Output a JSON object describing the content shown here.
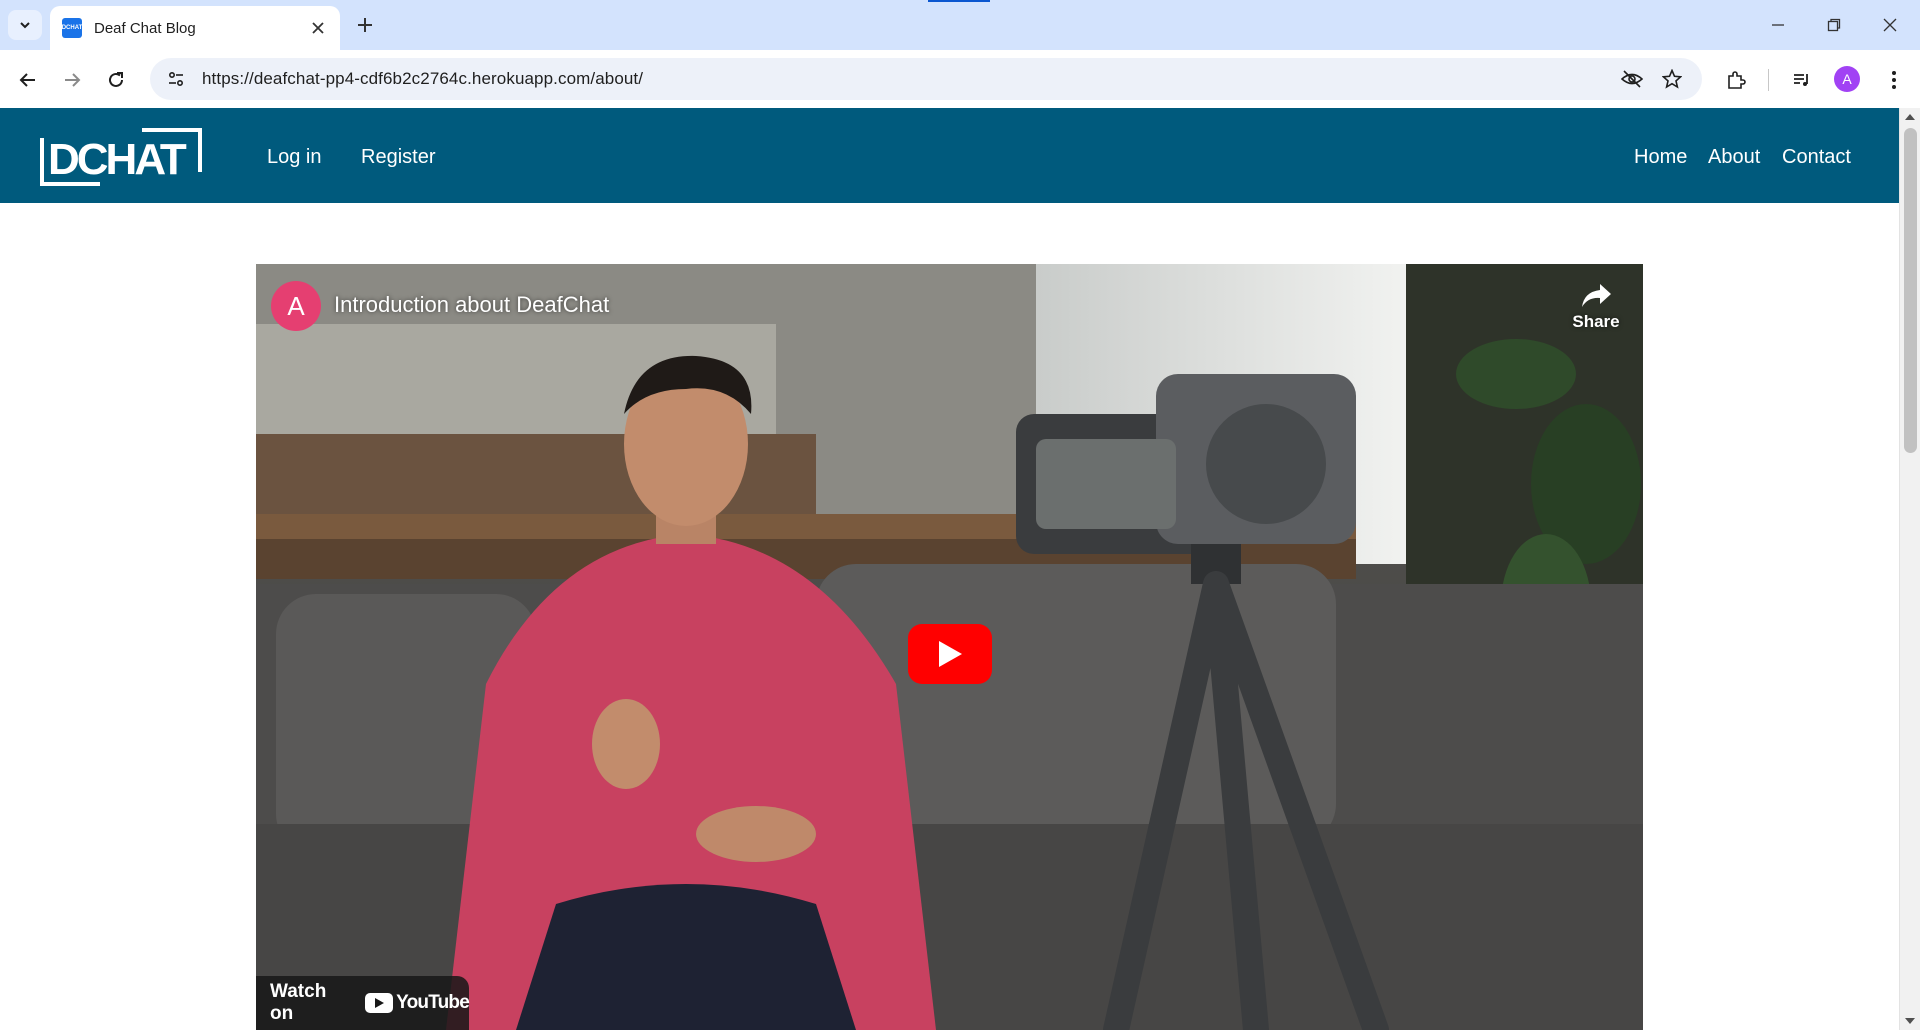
{
  "browser": {
    "tab_title": "Deaf Chat Blog",
    "favicon_text": "DCHAT",
    "url": "https://deafchat-pp4-cdf6b2c2764c.herokuapp.com/about/",
    "profile_initial": "A"
  },
  "site": {
    "logo_text": "DCHAT",
    "nav_left": {
      "login": "Log in",
      "register": "Register"
    },
    "nav_right": {
      "home": "Home",
      "about": "About",
      "contact": "Contact"
    },
    "brand_color": "#005a7d"
  },
  "video": {
    "channel_initial": "A",
    "title": "Introduction about DeafChat",
    "share_label": "Share",
    "watch_on": "Watch on",
    "platform": "YouTube"
  }
}
